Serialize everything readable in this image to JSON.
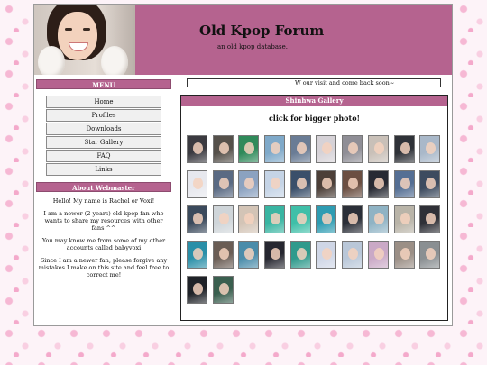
{
  "header": {
    "title": "Old Kpop Forum",
    "subtitle": "an old kpop database."
  },
  "menu": {
    "heading": "MENU",
    "items": [
      {
        "label": "Home"
      },
      {
        "label": "Profiles"
      },
      {
        "label": "Downloads"
      },
      {
        "label": "Star Gallery"
      },
      {
        "label": "FAQ"
      },
      {
        "label": "Links"
      }
    ]
  },
  "about": {
    "heading": "About Webmaster",
    "paragraphs": [
      "Hello! My name is Rachel or Voxi!",
      "I am a newer (2 years) old kpop fan who wants to share my resources with other fans ^^",
      "You may know me from some of my other accounts called babyvoxi",
      "Since I am a newer fan, please forgive any mistakes I make on this site and feel free to correct me!"
    ]
  },
  "marquee": "W  our visit and come back soon~",
  "gallery": {
    "heading": "Shinhwa Gallery",
    "note": "click for bigger photo!",
    "thumbs": [
      "#3b3a40",
      "#55504a",
      "#2f8a5a",
      "#7fa9c9",
      "#6a7c95",
      "#d6d2d7",
      "#8f8e96",
      "#c9c0b8",
      "#2f3238",
      "#a9b8c9",
      "#e7e8ee",
      "#5a6a83",
      "#8ba2c0",
      "#c5d4e6",
      "#3a4f6a",
      "#4c3f38",
      "#6b4f42",
      "#272a33",
      "#556f94",
      "#3d4b5f",
      "#3b4a5c",
      "#cfd5d9",
      "#d3c4b6",
      "#39b5a2",
      "#3fbfa8",
      "#2e9cb2",
      "#2b2f38",
      "#8fb3c4",
      "#b9b4a8",
      "#2f3037",
      "#2a8fa8",
      "#6a5d55",
      "#4a8caa",
      "#262730",
      "#2f9a8c",
      "#cfd6e6",
      "#b9c7d8",
      "#caa9c6",
      "#9b8f86",
      "#8a8f92",
      "#1f2228",
      "#3a5f4f"
    ]
  }
}
